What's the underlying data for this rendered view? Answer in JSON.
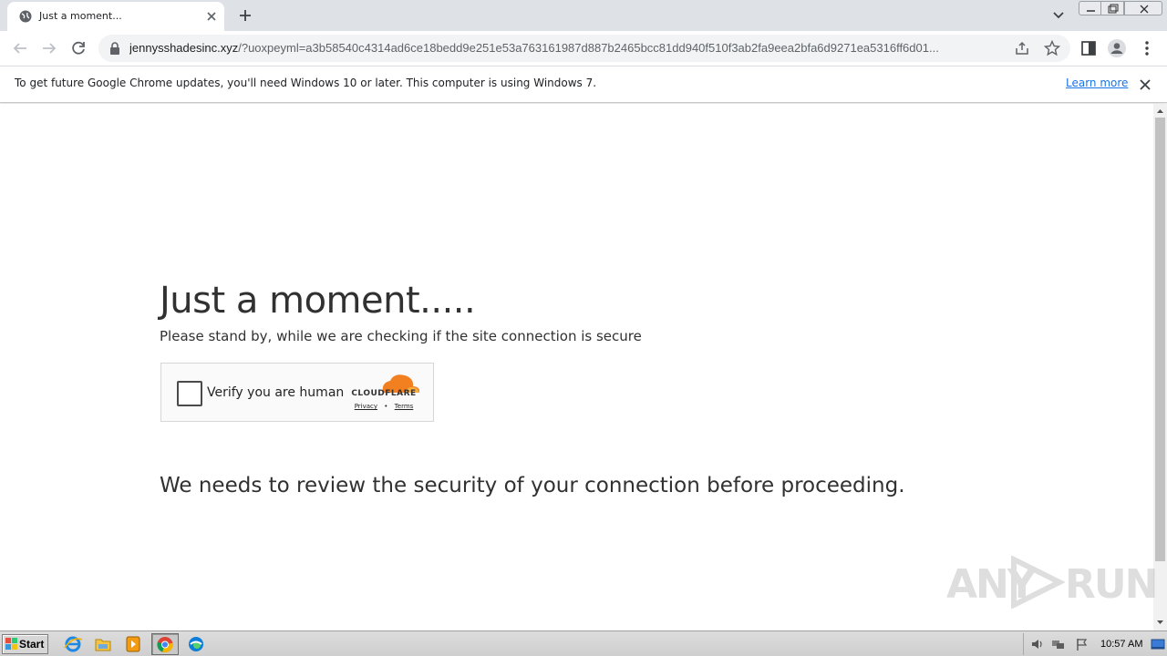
{
  "browser": {
    "tab": {
      "title": "Just a moment..."
    },
    "address": {
      "host": "jennysshadesinc.xyz",
      "path": "/?uoxpeyml=a3b58540c4314ad6ce18bedd9e251e53a763161987d887b2465bcc81dd940f510f3ab2fa9eea2bfa6d9271ea5316ff6d01..."
    }
  },
  "infobar": {
    "message": "To get future Google Chrome updates, you'll need Windows 10 or later. This computer is using Windows 7.",
    "link": "Learn more"
  },
  "page": {
    "heading": "Just a moment.....",
    "subtext": "Please stand by, while we are checking if the site connection is secure",
    "widget": {
      "label": "Verify you are human",
      "brand": "CLOUDFLARE",
      "privacy": "Privacy",
      "separator": "•",
      "terms": "Terms"
    },
    "review": "We needs to review the security of your connection before proceeding."
  },
  "watermark": {
    "left": "ANY",
    "right": "RUN"
  },
  "taskbar": {
    "start": "Start",
    "clock": "10:57 AM",
    "apps": [
      "ie-icon",
      "explorer-icon",
      "media-player-icon",
      "chrome-icon",
      "edge-icon"
    ]
  },
  "colors": {
    "accent": "#1a73e8",
    "cloudflare_orange": "#f38020",
    "text": "#313131"
  }
}
